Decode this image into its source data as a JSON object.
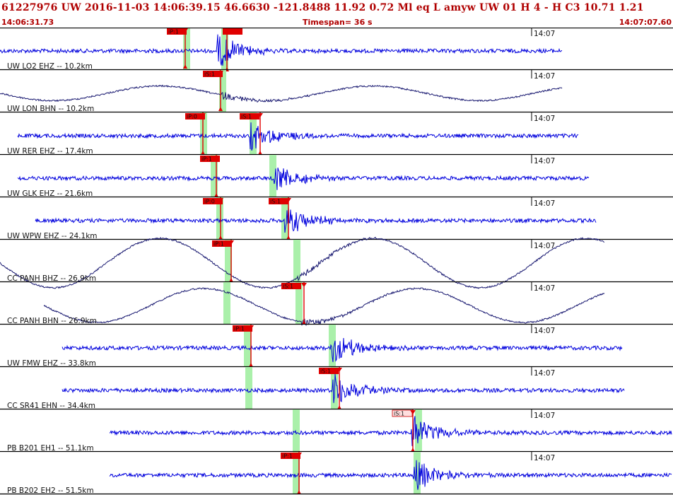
{
  "header": {
    "event_line": "61227976 UW 2016-11-03 14:06:39.15   46.6630 -121.8488  11.92  0.72 Ml  eq  L amyw     UW 01  H   4  -  H C3   10.71  1.21",
    "start_time": "14:06:31.73",
    "timespan": "Timespan=  36 s",
    "end_time": "14:07:07.60"
  },
  "colors": {
    "header_text": "#b00000",
    "trace_blue": "#0000dd",
    "trace_dark": "#181870",
    "pick_red": "#e00000",
    "window_green": "#aaf0aa",
    "separator": "#000000"
  },
  "minute_mark": "14:07",
  "traces": [
    {
      "label": "UW LO2 EHZ -- 10.2km",
      "picks": [
        {
          "text": "iP:1",
          "fill": "red"
        },
        {
          "text": "",
          "fill": "red"
        }
      ],
      "wave": "seismic"
    },
    {
      "label": "UW LON BHN -- 10.2km",
      "picks": [
        {
          "text": "iS:1",
          "fill": "red"
        }
      ],
      "wave": "swell"
    },
    {
      "label": "UW RER EHZ -- 17.4km",
      "picks": [
        {
          "text": "iP:0",
          "fill": "red"
        },
        {
          "text": "iS:1",
          "fill": "red"
        }
      ],
      "wave": "seismic"
    },
    {
      "label": "UW GLK EHZ -- 21.6km",
      "picks": [
        {
          "text": "iP:1",
          "fill": "red"
        }
      ],
      "wave": "seismic"
    },
    {
      "label": "UW WPW EHZ -- 24.1km",
      "picks": [
        {
          "text": "iP:0",
          "fill": "red"
        },
        {
          "text": "iS:1",
          "fill": "red"
        }
      ],
      "wave": "seismic"
    },
    {
      "label": "CC PANH BHZ -- 26.9km",
      "picks": [
        {
          "text": "iP:1",
          "fill": "red"
        }
      ],
      "wave": "swell"
    },
    {
      "label": "CC PANH BHN -- 26.9km",
      "picks": [
        {
          "text": "iS:1",
          "fill": "red"
        }
      ],
      "wave": "swell"
    },
    {
      "label": "UW FMW EHZ -- 33.8km",
      "picks": [
        {
          "text": "iP:1",
          "fill": "red"
        }
      ],
      "wave": "seismic"
    },
    {
      "label": "CC SR41 EHN -- 34.4km",
      "picks": [
        {
          "text": "iS:1",
          "fill": "red"
        }
      ],
      "wave": "seismic"
    },
    {
      "label": "PB B201 EH1 -- 51.1km",
      "picks": [
        {
          "text": "iS:1",
          "fill": "pink"
        }
      ],
      "wave": "seismic"
    },
    {
      "label": "PB B202 EH2 -- 51.5km",
      "picks": [
        {
          "text": "iP:1",
          "fill": "red"
        }
      ],
      "wave": "seismic"
    }
  ]
}
